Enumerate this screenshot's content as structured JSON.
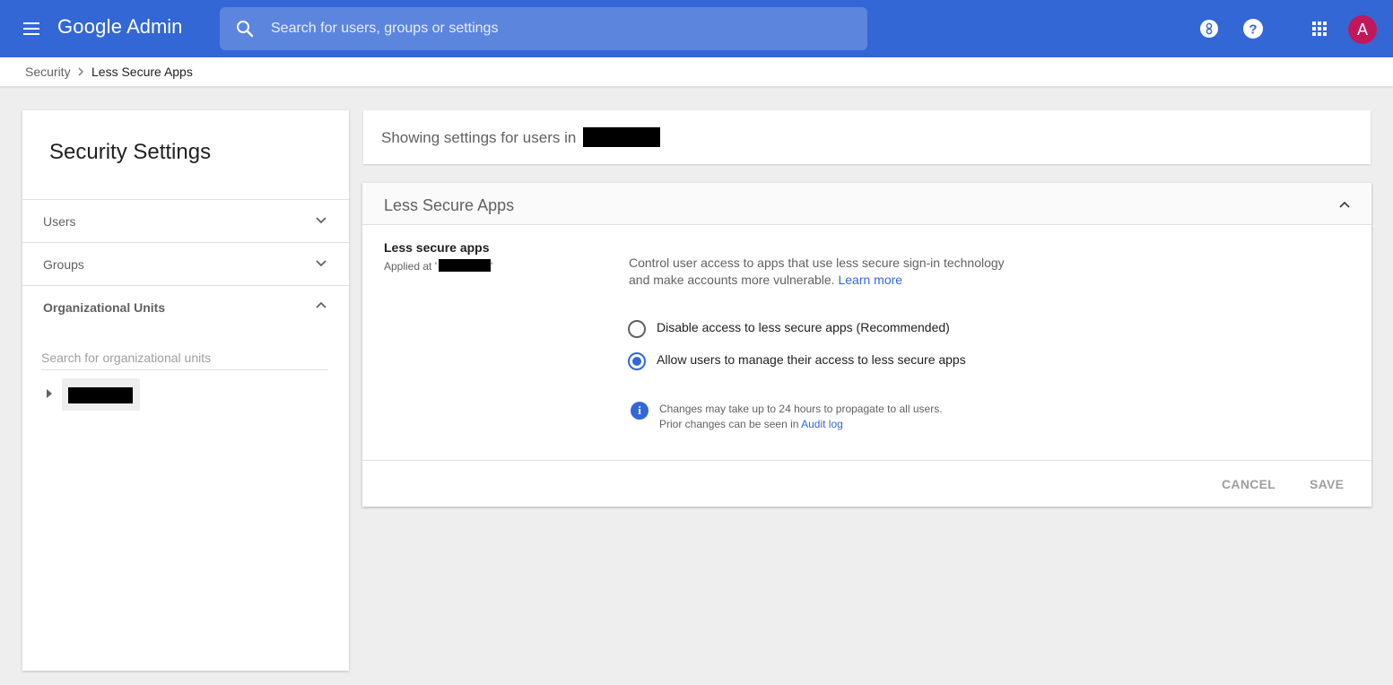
{
  "app": {
    "brand_google": "Google",
    "brand_admin": "Admin"
  },
  "search": {
    "placeholder": "Search for users, groups or settings"
  },
  "header": {
    "icons": [
      "menu-icon",
      "search-icon",
      "support-badge-icon",
      "help-icon",
      "apps-grid-icon"
    ],
    "avatar_letter": "A",
    "avatar_color": "#c2185b",
    "accent": "#3367d6"
  },
  "breadcrumb": {
    "parent": "Security",
    "current": "Less Secure Apps"
  },
  "sidebar": {
    "title": "Security Settings",
    "items": [
      {
        "label": "Users",
        "expanded": false
      },
      {
        "label": "Groups",
        "expanded": false
      },
      {
        "label": "Organizational Units",
        "expanded": true
      }
    ],
    "ou_search_placeholder": "Search for organizational units"
  },
  "main": {
    "showing_prefix": "Showing settings for users in",
    "section_title": "Less Secure Apps",
    "setting": {
      "name": "Less secure apps",
      "applied_prefix": "Applied at '",
      "applied_suffix": "'",
      "description": "Control user access to apps that use less secure sign-in technology and make accounts more vulnerable.",
      "learn_more": "Learn more",
      "options": [
        {
          "label": "Disable access to less secure apps (Recommended)",
          "selected": false
        },
        {
          "label": "Allow users to manage their access to less secure apps",
          "selected": true
        }
      ],
      "info_line1": "Changes may take up to 24 hours to propagate to all users.",
      "info_line2_prefix": "Prior changes can be seen in",
      "audit_log": "Audit log"
    },
    "buttons": {
      "cancel": "CANCEL",
      "save": "SAVE"
    }
  }
}
